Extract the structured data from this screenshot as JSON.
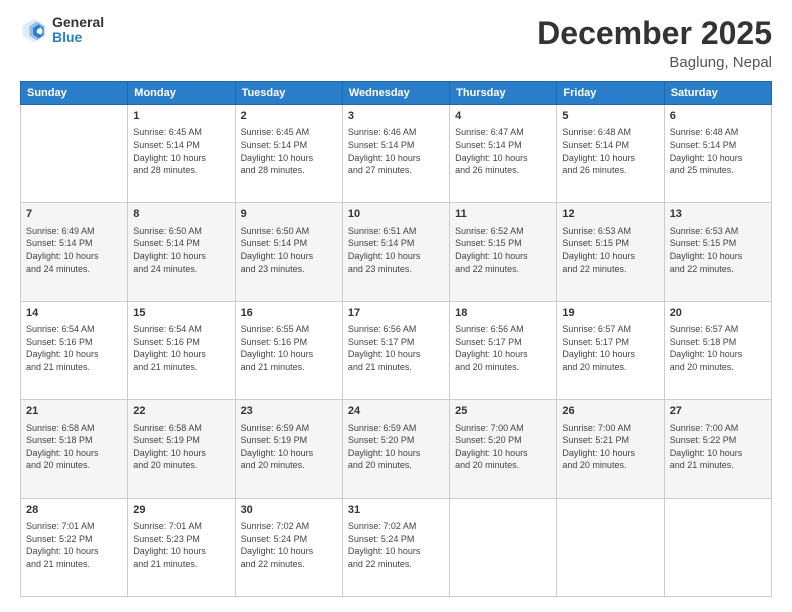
{
  "header": {
    "logo_general": "General",
    "logo_blue": "Blue",
    "month_year": "December 2025",
    "location": "Baglung, Nepal"
  },
  "days_of_week": [
    "Sunday",
    "Monday",
    "Tuesday",
    "Wednesday",
    "Thursday",
    "Friday",
    "Saturday"
  ],
  "weeks": [
    [
      {
        "day": "",
        "lines": []
      },
      {
        "day": "1",
        "lines": [
          "Sunrise: 6:45 AM",
          "Sunset: 5:14 PM",
          "Daylight: 10 hours",
          "and 28 minutes."
        ]
      },
      {
        "day": "2",
        "lines": [
          "Sunrise: 6:45 AM",
          "Sunset: 5:14 PM",
          "Daylight: 10 hours",
          "and 28 minutes."
        ]
      },
      {
        "day": "3",
        "lines": [
          "Sunrise: 6:46 AM",
          "Sunset: 5:14 PM",
          "Daylight: 10 hours",
          "and 27 minutes."
        ]
      },
      {
        "day": "4",
        "lines": [
          "Sunrise: 6:47 AM",
          "Sunset: 5:14 PM",
          "Daylight: 10 hours",
          "and 26 minutes."
        ]
      },
      {
        "day": "5",
        "lines": [
          "Sunrise: 6:48 AM",
          "Sunset: 5:14 PM",
          "Daylight: 10 hours",
          "and 26 minutes."
        ]
      },
      {
        "day": "6",
        "lines": [
          "Sunrise: 6:48 AM",
          "Sunset: 5:14 PM",
          "Daylight: 10 hours",
          "and 25 minutes."
        ]
      }
    ],
    [
      {
        "day": "7",
        "lines": [
          "Sunrise: 6:49 AM",
          "Sunset: 5:14 PM",
          "Daylight: 10 hours",
          "and 24 minutes."
        ]
      },
      {
        "day": "8",
        "lines": [
          "Sunrise: 6:50 AM",
          "Sunset: 5:14 PM",
          "Daylight: 10 hours",
          "and 24 minutes."
        ]
      },
      {
        "day": "9",
        "lines": [
          "Sunrise: 6:50 AM",
          "Sunset: 5:14 PM",
          "Daylight: 10 hours",
          "and 23 minutes."
        ]
      },
      {
        "day": "10",
        "lines": [
          "Sunrise: 6:51 AM",
          "Sunset: 5:14 PM",
          "Daylight: 10 hours",
          "and 23 minutes."
        ]
      },
      {
        "day": "11",
        "lines": [
          "Sunrise: 6:52 AM",
          "Sunset: 5:15 PM",
          "Daylight: 10 hours",
          "and 22 minutes."
        ]
      },
      {
        "day": "12",
        "lines": [
          "Sunrise: 6:53 AM",
          "Sunset: 5:15 PM",
          "Daylight: 10 hours",
          "and 22 minutes."
        ]
      },
      {
        "day": "13",
        "lines": [
          "Sunrise: 6:53 AM",
          "Sunset: 5:15 PM",
          "Daylight: 10 hours",
          "and 22 minutes."
        ]
      }
    ],
    [
      {
        "day": "14",
        "lines": [
          "Sunrise: 6:54 AM",
          "Sunset: 5:16 PM",
          "Daylight: 10 hours",
          "and 21 minutes."
        ]
      },
      {
        "day": "15",
        "lines": [
          "Sunrise: 6:54 AM",
          "Sunset: 5:16 PM",
          "Daylight: 10 hours",
          "and 21 minutes."
        ]
      },
      {
        "day": "16",
        "lines": [
          "Sunrise: 6:55 AM",
          "Sunset: 5:16 PM",
          "Daylight: 10 hours",
          "and 21 minutes."
        ]
      },
      {
        "day": "17",
        "lines": [
          "Sunrise: 6:56 AM",
          "Sunset: 5:17 PM",
          "Daylight: 10 hours",
          "and 21 minutes."
        ]
      },
      {
        "day": "18",
        "lines": [
          "Sunrise: 6:56 AM",
          "Sunset: 5:17 PM",
          "Daylight: 10 hours",
          "and 20 minutes."
        ]
      },
      {
        "day": "19",
        "lines": [
          "Sunrise: 6:57 AM",
          "Sunset: 5:17 PM",
          "Daylight: 10 hours",
          "and 20 minutes."
        ]
      },
      {
        "day": "20",
        "lines": [
          "Sunrise: 6:57 AM",
          "Sunset: 5:18 PM",
          "Daylight: 10 hours",
          "and 20 minutes."
        ]
      }
    ],
    [
      {
        "day": "21",
        "lines": [
          "Sunrise: 6:58 AM",
          "Sunset: 5:18 PM",
          "Daylight: 10 hours",
          "and 20 minutes."
        ]
      },
      {
        "day": "22",
        "lines": [
          "Sunrise: 6:58 AM",
          "Sunset: 5:19 PM",
          "Daylight: 10 hours",
          "and 20 minutes."
        ]
      },
      {
        "day": "23",
        "lines": [
          "Sunrise: 6:59 AM",
          "Sunset: 5:19 PM",
          "Daylight: 10 hours",
          "and 20 minutes."
        ]
      },
      {
        "day": "24",
        "lines": [
          "Sunrise: 6:59 AM",
          "Sunset: 5:20 PM",
          "Daylight: 10 hours",
          "and 20 minutes."
        ]
      },
      {
        "day": "25",
        "lines": [
          "Sunrise: 7:00 AM",
          "Sunset: 5:20 PM",
          "Daylight: 10 hours",
          "and 20 minutes."
        ]
      },
      {
        "day": "26",
        "lines": [
          "Sunrise: 7:00 AM",
          "Sunset: 5:21 PM",
          "Daylight: 10 hours",
          "and 20 minutes."
        ]
      },
      {
        "day": "27",
        "lines": [
          "Sunrise: 7:00 AM",
          "Sunset: 5:22 PM",
          "Daylight: 10 hours",
          "and 21 minutes."
        ]
      }
    ],
    [
      {
        "day": "28",
        "lines": [
          "Sunrise: 7:01 AM",
          "Sunset: 5:22 PM",
          "Daylight: 10 hours",
          "and 21 minutes."
        ]
      },
      {
        "day": "29",
        "lines": [
          "Sunrise: 7:01 AM",
          "Sunset: 5:23 PM",
          "Daylight: 10 hours",
          "and 21 minutes."
        ]
      },
      {
        "day": "30",
        "lines": [
          "Sunrise: 7:02 AM",
          "Sunset: 5:24 PM",
          "Daylight: 10 hours",
          "and 22 minutes."
        ]
      },
      {
        "day": "31",
        "lines": [
          "Sunrise: 7:02 AM",
          "Sunset: 5:24 PM",
          "Daylight: 10 hours",
          "and 22 minutes."
        ]
      },
      {
        "day": "",
        "lines": []
      },
      {
        "day": "",
        "lines": []
      },
      {
        "day": "",
        "lines": []
      }
    ]
  ]
}
